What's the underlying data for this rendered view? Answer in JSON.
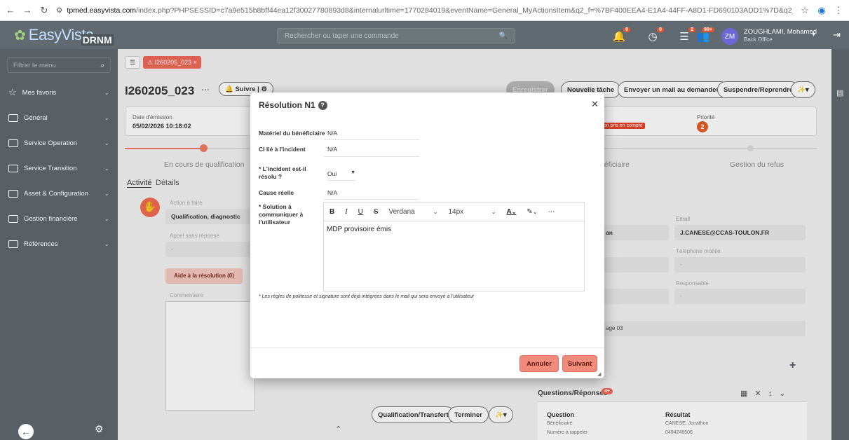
{
  "browser": {
    "url_domain": "tpmed.easyvista.com",
    "url_rest": "/index.php?PHPSESSID=c7a9e515b8bff44ea12f30027780893d8&internalurltime=1770284019&eventName=General_MyActionsItem&q2_f=%7BF400EEA4-E1A4-44FF-A8D1-FD690103ADD1%7D&q2_r=%7B43282140-F301-412C-A07F-73D8390..."
  },
  "header": {
    "logo_top": "EasyVista",
    "logo_bottom": "DRNM",
    "command_placeholder": "Rechercher ou taper une commande",
    "badges": [
      "0",
      "0",
      "2",
      "99+"
    ],
    "avatar": "ZM",
    "user_name": "ZOUGHLAMI, Mohamed",
    "user_role": "Back Office"
  },
  "sidebar": {
    "filter_placeholder": "Filtrer le menu",
    "favorites": "Mes favoris",
    "items": [
      {
        "label": "Général"
      },
      {
        "label": "Service Operation"
      },
      {
        "label": "Service Transition"
      },
      {
        "label": "Asset & Configuration"
      },
      {
        "label": "Gestion financière"
      },
      {
        "label": "Références"
      }
    ]
  },
  "tabs": {
    "ticket_tab": "I260205_023"
  },
  "ticket": {
    "id": "I260205_023",
    "follow": "Suivre",
    "actions": [
      "Enregistrer",
      "Nouvelle tâche",
      "Envoyer un mail au demandeur",
      "Suspendre/Reprendre"
    ],
    "date_label": "Date d'émission",
    "date_value": "05/02/2026 10:18:02",
    "status_tag": "non pris en compte",
    "priority_label": "Priorité",
    "priority_value": "2",
    "steps": [
      "En cours de qualification",
      "Bénéficiaire",
      "Gestion du refus"
    ],
    "tab_activity": "Activité",
    "tab_details": "Détails",
    "action_label": "Action à faire",
    "action_value": "Qualification, diagnostic",
    "call_label": "Appel sans réponse",
    "call_value": "-",
    "help_button": "Aide à la résolution (0)",
    "comment_label": "Commentaire",
    "email_label": "Email",
    "email_value": "J.CANESE@CCAS-TOULON.FR",
    "name_fragment": "an",
    "mobile_label": "Téléphone mobile",
    "responsable_label": "Responsable",
    "dash": "-",
    "site_value": "age 03",
    "qr_title": "Questions/Réponses",
    "qr_badge": "4+",
    "qr_col1": "Question",
    "qr_col2": "Résultat",
    "qr_rows": [
      {
        "q": "Bénéficiaire",
        "r": "CANESE, Jonathon"
      },
      {
        "q": "Numéro à rappeler",
        "r": "0494246506"
      }
    ],
    "bottom_buttons": [
      "Qualification/Transfert",
      "Terminer"
    ]
  },
  "modal": {
    "title": "Résolution N1",
    "fields": [
      {
        "label": "Matériel du bénéficiaire",
        "value": "N/A"
      },
      {
        "label": "CI lié à l'incident",
        "value": "N/A"
      }
    ],
    "resolved_label": "* L'incident est-il résolu ?",
    "resolved_value": "Oui",
    "cause_label": "Cause réelle",
    "cause_value": "N/A",
    "solution_label": "* Solution à communiquer à l'utilisateur",
    "editor_font": "Verdana",
    "editor_size": "14px",
    "editor_content": "MDP provisoire émis",
    "note": "* Les règles de politesse et signature sont déjà intégrées dans le mail qui sera envoyé à l'utilisateur",
    "cancel": "Annuler",
    "next": "Suivant"
  }
}
